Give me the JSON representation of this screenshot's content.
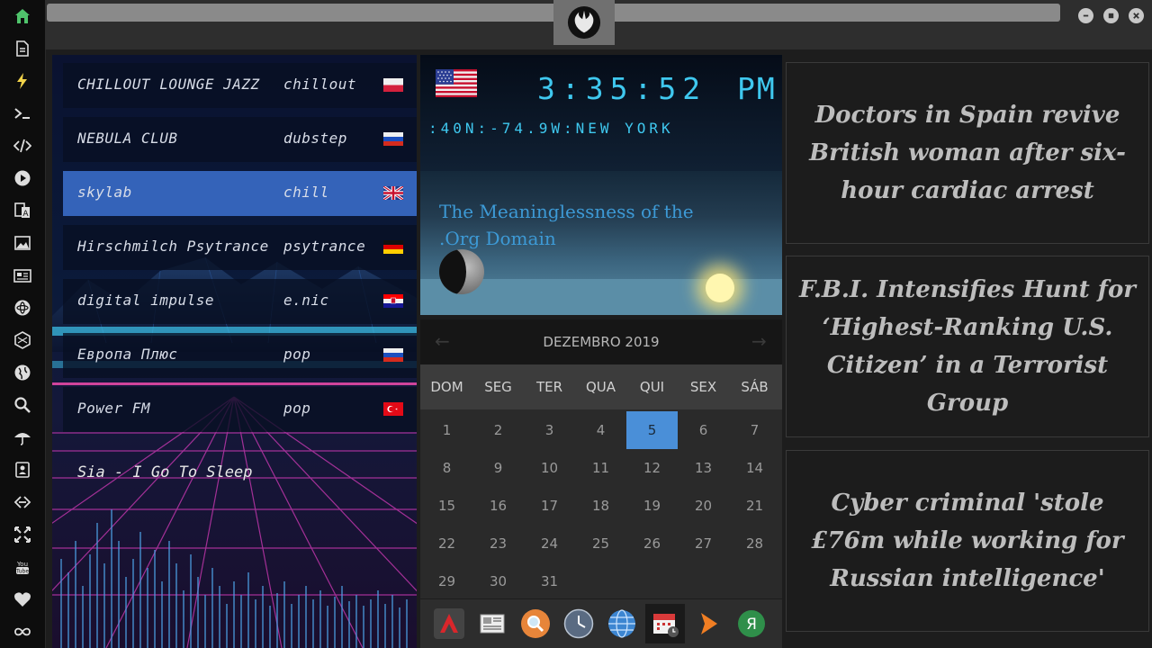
{
  "colors": {
    "accent": "#3fc8ef",
    "calendar_today": "#4a8fd8",
    "link": "#3d9ad6",
    "home_icon": "#4fc36b",
    "bolt_icon": "#f2d34a"
  },
  "sidebar": {
    "items": [
      {
        "icon": "home-icon"
      },
      {
        "icon": "document-icon"
      },
      {
        "icon": "bolt-icon"
      },
      {
        "icon": "terminal-icon"
      },
      {
        "icon": "code-icon"
      },
      {
        "icon": "play-icon"
      },
      {
        "icon": "translate-icon"
      },
      {
        "icon": "image-icon"
      },
      {
        "icon": "newspaper-icon"
      },
      {
        "icon": "atom-icon"
      },
      {
        "icon": "hexagon-icon"
      },
      {
        "icon": "globe-icon"
      },
      {
        "icon": "search-icon"
      },
      {
        "icon": "umbrella-icon"
      },
      {
        "icon": "contacts-icon"
      },
      {
        "icon": "link-icon"
      },
      {
        "icon": "expand-icon"
      },
      {
        "icon": "youtube-icon"
      },
      {
        "icon": "heart-icon"
      },
      {
        "icon": "infinity-icon"
      }
    ]
  },
  "radio": {
    "stations": [
      {
        "name": "CHILLOUT LOUNGE JAZZ",
        "genre": "chillout",
        "flag": "poland",
        "active": false
      },
      {
        "name": "NEBULA CLUB",
        "genre": "dubstep",
        "flag": "russia",
        "active": false
      },
      {
        "name": "skylab",
        "genre": "chill",
        "flag": "united-kingdom",
        "active": true
      },
      {
        "name": "Hirschmilch Psytrance",
        "genre": "psytrance",
        "flag": "germany",
        "active": false
      },
      {
        "name": "digital impulse",
        "genre": "e.nic",
        "flag": "croatia",
        "active": false
      },
      {
        "name": "Европа Плюс",
        "genre": "pop",
        "flag": "russia",
        "active": false
      },
      {
        "name": "Power FM",
        "genre": "pop",
        "flag": "turkey",
        "active": false
      }
    ],
    "now_playing": "Sia - I Go To Sleep"
  },
  "clock": {
    "flag": "united-states",
    "time": "3:35:52",
    "ampm": "PM",
    "location": ":40N:-74.9W:NEW YORK",
    "article_title": "The Meaninglessness of the .Org Domain"
  },
  "calendar": {
    "month_label": "DEZEMBRO 2019",
    "weekdays": [
      "DOM",
      "SEG",
      "TER",
      "QUA",
      "QUI",
      "SEX",
      "SÁB"
    ],
    "days": [
      "1",
      "2",
      "3",
      "4",
      "5",
      "6",
      "7",
      "8",
      "9",
      "10",
      "11",
      "12",
      "13",
      "14",
      "15",
      "16",
      "17",
      "18",
      "19",
      "20",
      "21",
      "22",
      "23",
      "24",
      "25",
      "26",
      "27",
      "28",
      "29",
      "30",
      "31"
    ],
    "today": "5"
  },
  "dock": {
    "items": [
      {
        "icon": "arch-launcher-icon"
      },
      {
        "icon": "news-reader-icon"
      },
      {
        "icon": "search-app-icon"
      },
      {
        "icon": "clock-app-icon"
      },
      {
        "icon": "globe-app-icon"
      },
      {
        "icon": "calendar-app-icon"
      },
      {
        "icon": "play-arrow-app-icon"
      },
      {
        "icon": "yandex-icon"
      }
    ]
  },
  "news": [
    {
      "headline": "Doctors in Spain revive British woman after six-hour cardiac arrest"
    },
    {
      "headline": "F.B.I. Intensifies Hunt for ‘Highest-Ranking U.S. Citizen’ in a Terrorist Group"
    },
    {
      "headline": "Cyber criminal 'stole £76m while working for Russian intelligence'"
    }
  ]
}
